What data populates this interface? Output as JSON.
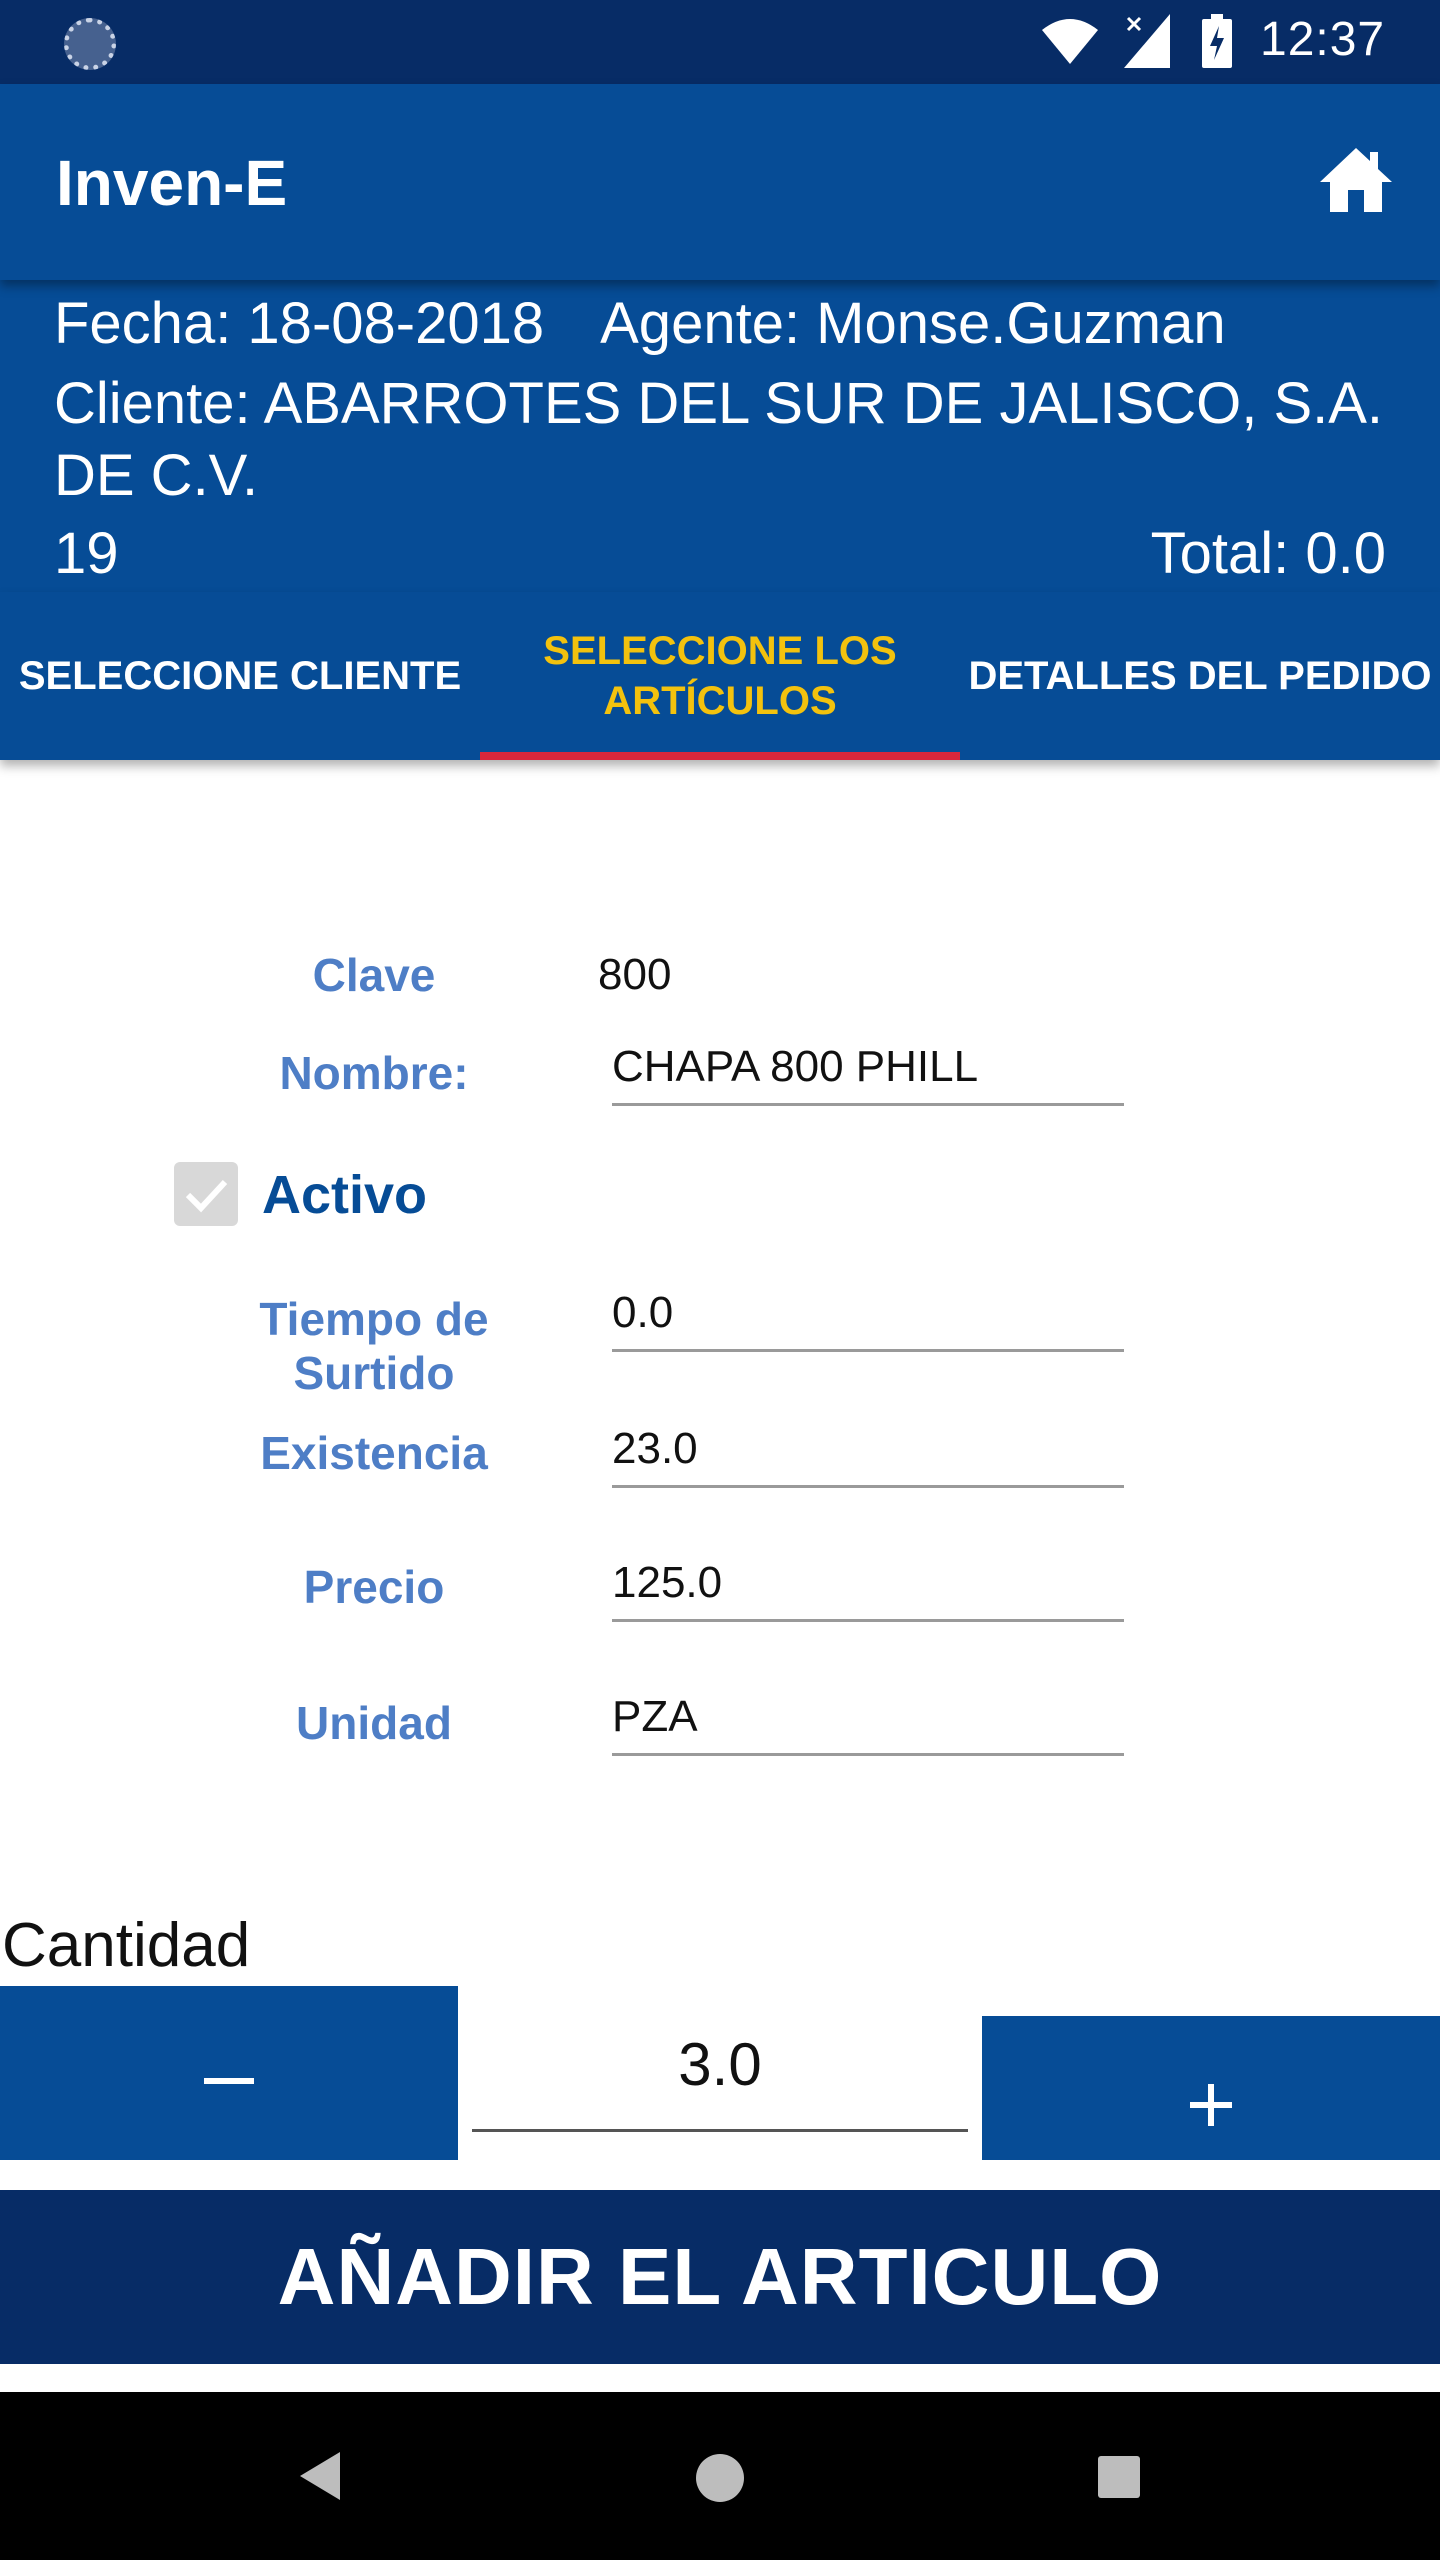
{
  "status_bar": {
    "time": "12:37",
    "icons": [
      "sync-icon",
      "wifi-icon",
      "signal-icon",
      "battery-charging-icon"
    ]
  },
  "app_bar": {
    "title": "Inven-E",
    "home_icon": "home-icon"
  },
  "order_info": {
    "fecha": "Fecha: 18-08-2018",
    "agente": "Agente: Monse.Guzman",
    "cliente": "Cliente: ABARROTES DEL SUR DE JALISCO, S.A. DE C.V.",
    "numero": "19",
    "total": "Total: 0.0"
  },
  "tabs": [
    {
      "label": "SELECCIONE CLIENTE",
      "active": false
    },
    {
      "label": "SELECCIONE LOS ARTÍCULOS",
      "active": true
    },
    {
      "label": "DETALLES DEL PEDIDO",
      "active": false
    }
  ],
  "form": {
    "clave_label": "Clave",
    "clave_value": "800",
    "nombre_label": "Nombre:",
    "nombre_value": "CHAPA 800 PHILL",
    "activo_label": "Activo",
    "activo_checked": true,
    "tiempo_label": "Tiempo de Surtido",
    "tiempo_value": "0.0",
    "existencia_label": "Existencia",
    "existencia_value": "23.0",
    "precio_label": "Precio",
    "precio_value": "125.0",
    "unidad_label": "Unidad",
    "unidad_value": "PZA"
  },
  "cantidad": {
    "label": "Cantidad",
    "value": "3.0",
    "decrement_label": "−",
    "increment_label": "+"
  },
  "add_button": {
    "label": "AÑADIR EL ARTICULO"
  },
  "colors": {
    "primary": "#064c96",
    "primary_dark": "#072c66",
    "accent_tab_text": "#f3c20e",
    "tab_indicator": "#d9273c",
    "field_label": "#4e7ec6"
  }
}
